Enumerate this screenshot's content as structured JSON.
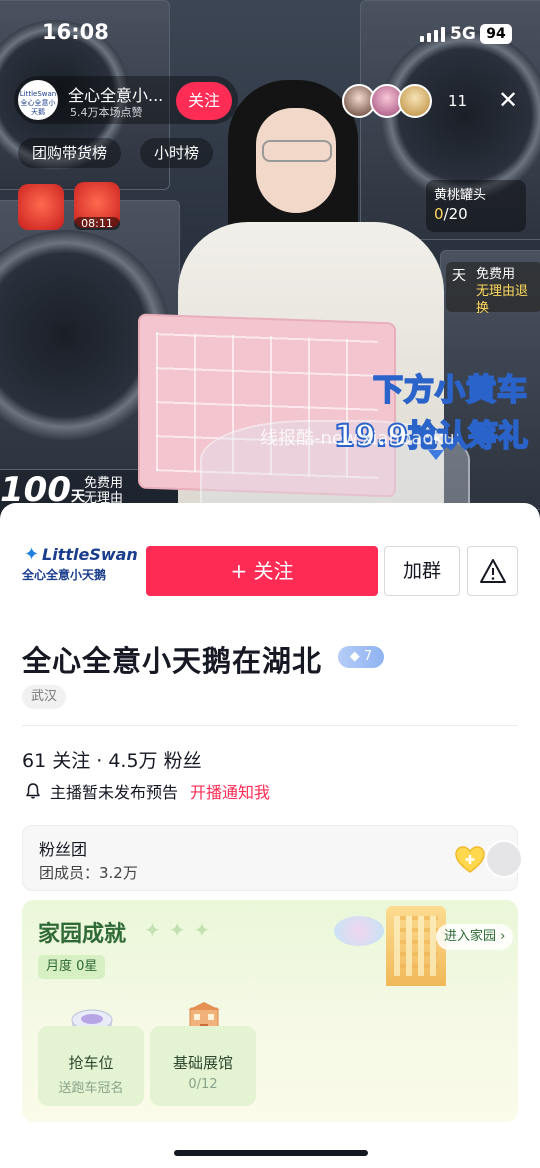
{
  "status_bar": {
    "time": "16:08",
    "network": "5G",
    "battery": "94"
  },
  "live": {
    "anchor_name": "全心全意小...",
    "anchor_likes": "5.4万本场点赞",
    "anchor_avatar_text": "LittleSwan 全心全意小天鹅",
    "follow_label": "关注",
    "viewer_count": "11",
    "close_label": "✕",
    "tags": [
      "团购带货榜",
      "小时榜"
    ],
    "redbag_timer": "08:11",
    "peach_card": {
      "title": "黄桃罐头",
      "progress_done": "0",
      "progress_total": "/20"
    },
    "promo_line1": "下方小黄车",
    "promo_line2": "19.9抢认筹礼",
    "watermark": "线报酷-new.xianbaoku",
    "badge_100": "100",
    "badge_100_unit": "天",
    "free_use_left_1": "免费用",
    "free_use_left_2": "无理由",
    "free_use_right_day": "天",
    "free_use_right_1": "免费用",
    "free_use_right_2": "无理由退换"
  },
  "sheet": {
    "brand_top": "LittleSwan",
    "brand_bottom": "全心全意小天鹅",
    "follow_button": "+ 关注",
    "group_button": "加群",
    "title": "全心全意小天鹅在湖北",
    "level": "7",
    "city": "武汉",
    "counts": "61 关注 · 4.5万 粉丝",
    "notice_text": "主播暂未发布预告",
    "notice_link": "开播通知我",
    "fans_club": {
      "title": "粉丝团",
      "members": "团成员：3.2万"
    },
    "home": {
      "title": "家园成就",
      "month_tag": "月度 0星",
      "enter": "进入家园 ›",
      "items": [
        {
          "name": "抢车位",
          "sub": "送跑车冠名"
        },
        {
          "name": "基础展馆",
          "sub": "0/12"
        }
      ]
    }
  },
  "colors": {
    "accent": "#fe2c55",
    "brand_blue": "#1b3e8c",
    "home_green": "#2f6a36"
  }
}
